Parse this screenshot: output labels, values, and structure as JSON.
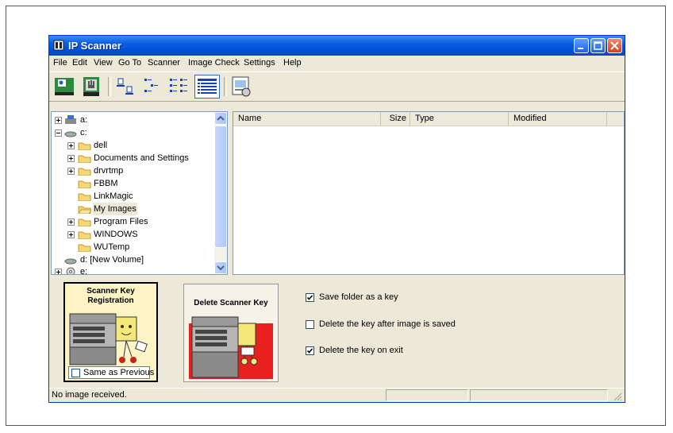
{
  "window": {
    "title": "IP Scanner"
  },
  "menu": [
    "File",
    "Edit",
    "View",
    "Go To",
    "Scanner",
    "Image Check",
    "Settings",
    "Help"
  ],
  "toolbar": {
    "buttons": [
      "scanner-setup-icon",
      "scan-hand-icon",
      "large-icons-view-icon",
      "small-icons-view-icon",
      "list-view-icon",
      "details-view-icon",
      "image-check-icon"
    ]
  },
  "tree": {
    "items": [
      {
        "label": "a:",
        "icon": "floppy-drive-icon"
      },
      {
        "label": "c:",
        "icon": "hard-drive-icon"
      },
      {
        "label": "dell",
        "icon": "folder-icon"
      },
      {
        "label": "Documents and Settings",
        "icon": "folder-icon"
      },
      {
        "label": "drvrtmp",
        "icon": "folder-icon"
      },
      {
        "label": "FBBM",
        "icon": "folder-icon"
      },
      {
        "label": "LinkMagic",
        "icon": "folder-icon"
      },
      {
        "label": "My Images",
        "icon": "folder-icon",
        "selected": true
      },
      {
        "label": "Program Files",
        "icon": "folder-icon"
      },
      {
        "label": "WINDOWS",
        "icon": "folder-icon"
      },
      {
        "label": "WUTemp",
        "icon": "folder-icon"
      },
      {
        "label": "d: [New Volume]",
        "icon": "hard-drive-icon"
      },
      {
        "label": "e:",
        "icon": "cd-drive-icon"
      }
    ]
  },
  "list": {
    "columns": [
      "Name",
      "Size",
      "Type",
      "Modified"
    ]
  },
  "panel": {
    "registration_title": "Scanner Key Registration",
    "same_as_previous": "Same as Previous",
    "same_as_previous_checked": false,
    "delete_title": "Delete Scanner Key",
    "options": [
      {
        "label": "Save folder as a key",
        "checked": true
      },
      {
        "label": "Delete the key after image is saved",
        "checked": false
      },
      {
        "label": "Delete the key on exit",
        "checked": true
      }
    ]
  },
  "status": {
    "text": "No image received."
  },
  "colors": {
    "title_bar": "#0a5ce0",
    "registration_card": "#fdf4c6",
    "delete_card_red": "#e8201e"
  }
}
